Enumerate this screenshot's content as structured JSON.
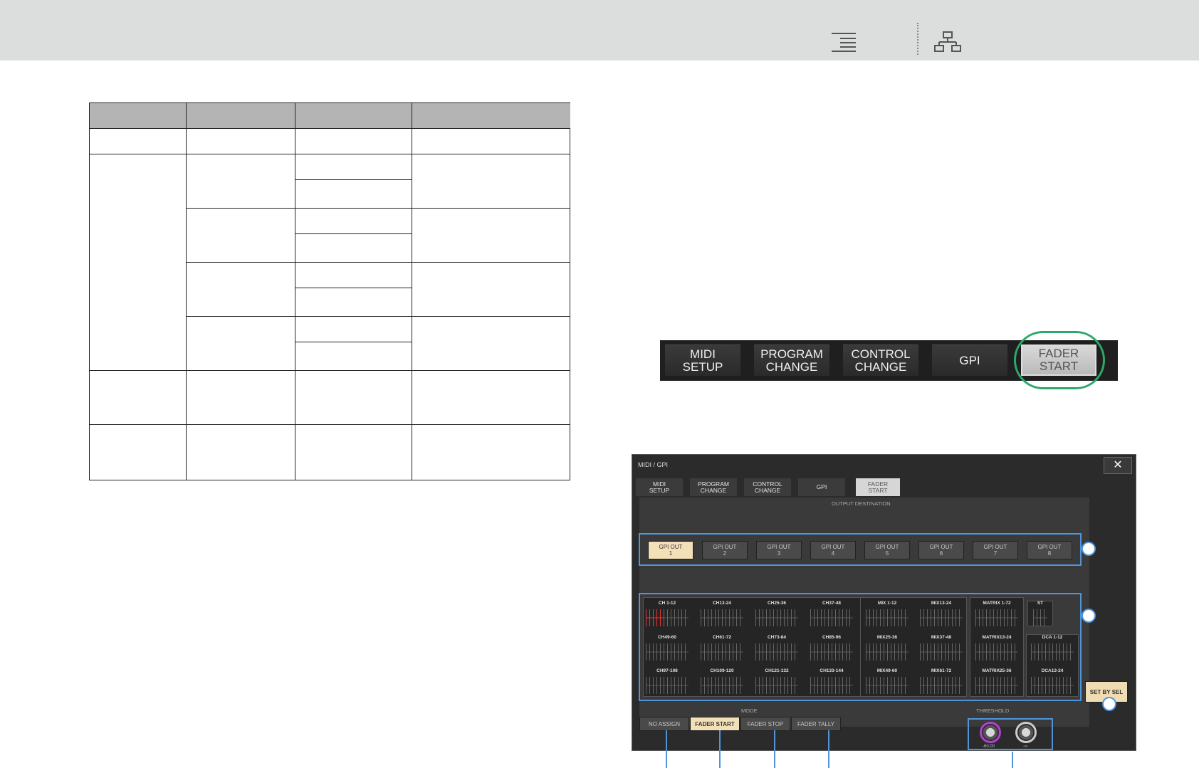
{
  "header": {
    "toc_icon": "table-of-contents-icon",
    "structure_icon": "hierarchy-icon"
  },
  "tabstrip": {
    "tabs": [
      {
        "label": "MIDI\nSETUP",
        "active": false
      },
      {
        "label": "PROGRAM\nCHANGE",
        "active": false
      },
      {
        "label": "CONTROL\nCHANGE",
        "active": false
      },
      {
        "label": "GPI",
        "active": false
      },
      {
        "label": "FADER\nSTART",
        "active": true
      }
    ],
    "highlight_color": "#2ea86a"
  },
  "panel": {
    "title": "MIDI / GPI",
    "close_label": "✕",
    "tabs": [
      {
        "label": "MIDI\nSETUP",
        "active": false
      },
      {
        "label": "PROGRAM\nCHANGE",
        "active": false
      },
      {
        "label": "CONTROL\nCHANGE",
        "active": false
      },
      {
        "label": "GPI",
        "active": false
      },
      {
        "label": "FADER\nSTART",
        "active": true
      }
    ],
    "output_destination_label": "OUTPUT DESTINATION",
    "gpi_outputs": [
      {
        "label": "GPI OUT\n1",
        "active": true
      },
      {
        "label": "GPI OUT\n2",
        "active": false
      },
      {
        "label": "GPI OUT\n3",
        "active": false
      },
      {
        "label": "GPI OUT\n4",
        "active": false
      },
      {
        "label": "GPI OUT\n5",
        "active": false
      },
      {
        "label": "GPI OUT\n6",
        "active": false
      },
      {
        "label": "GPI OUT\n7",
        "active": false
      },
      {
        "label": "GPI OUT\n8",
        "active": false
      }
    ],
    "channel_groups": {
      "input": [
        [
          "CH 1-12",
          "CH13-24",
          "CH25-36",
          "CH37-48"
        ],
        [
          "CH49-60",
          "CH61-72",
          "CH73-84",
          "CH85-96"
        ],
        [
          "CH97-108",
          "CH109-120",
          "CH121-132",
          "CH133-144"
        ]
      ],
      "mix": [
        [
          "MIX 1-12",
          "MIX13-24"
        ],
        [
          "MIX25-36",
          "MIX37-48"
        ],
        [
          "MIX49-60",
          "MIX61-72"
        ]
      ],
      "matrix": [
        "MATRIX 1-72",
        "MATRIX13-24",
        "MATRIX25-36"
      ],
      "stereo": "ST",
      "dca": [
        "DCA 1-12",
        "DCA13-24"
      ]
    },
    "set_by_sel_label": "SET BY SEL",
    "mode_label": "MODE",
    "mode_buttons": [
      {
        "label": "NO ASSIGN",
        "active": false
      },
      {
        "label": "FADER START",
        "active": true
      },
      {
        "label": "FADER STOP",
        "active": false
      },
      {
        "label": "FADER TALLY",
        "active": false
      }
    ],
    "threshold_label": "THRESHOLD",
    "threshold_knobs": [
      {
        "value": "-60.00",
        "color": "#b23fd6"
      },
      {
        "value": "-∞",
        "color": "#cccccc"
      }
    ],
    "accent_color": "#4f95d9"
  }
}
